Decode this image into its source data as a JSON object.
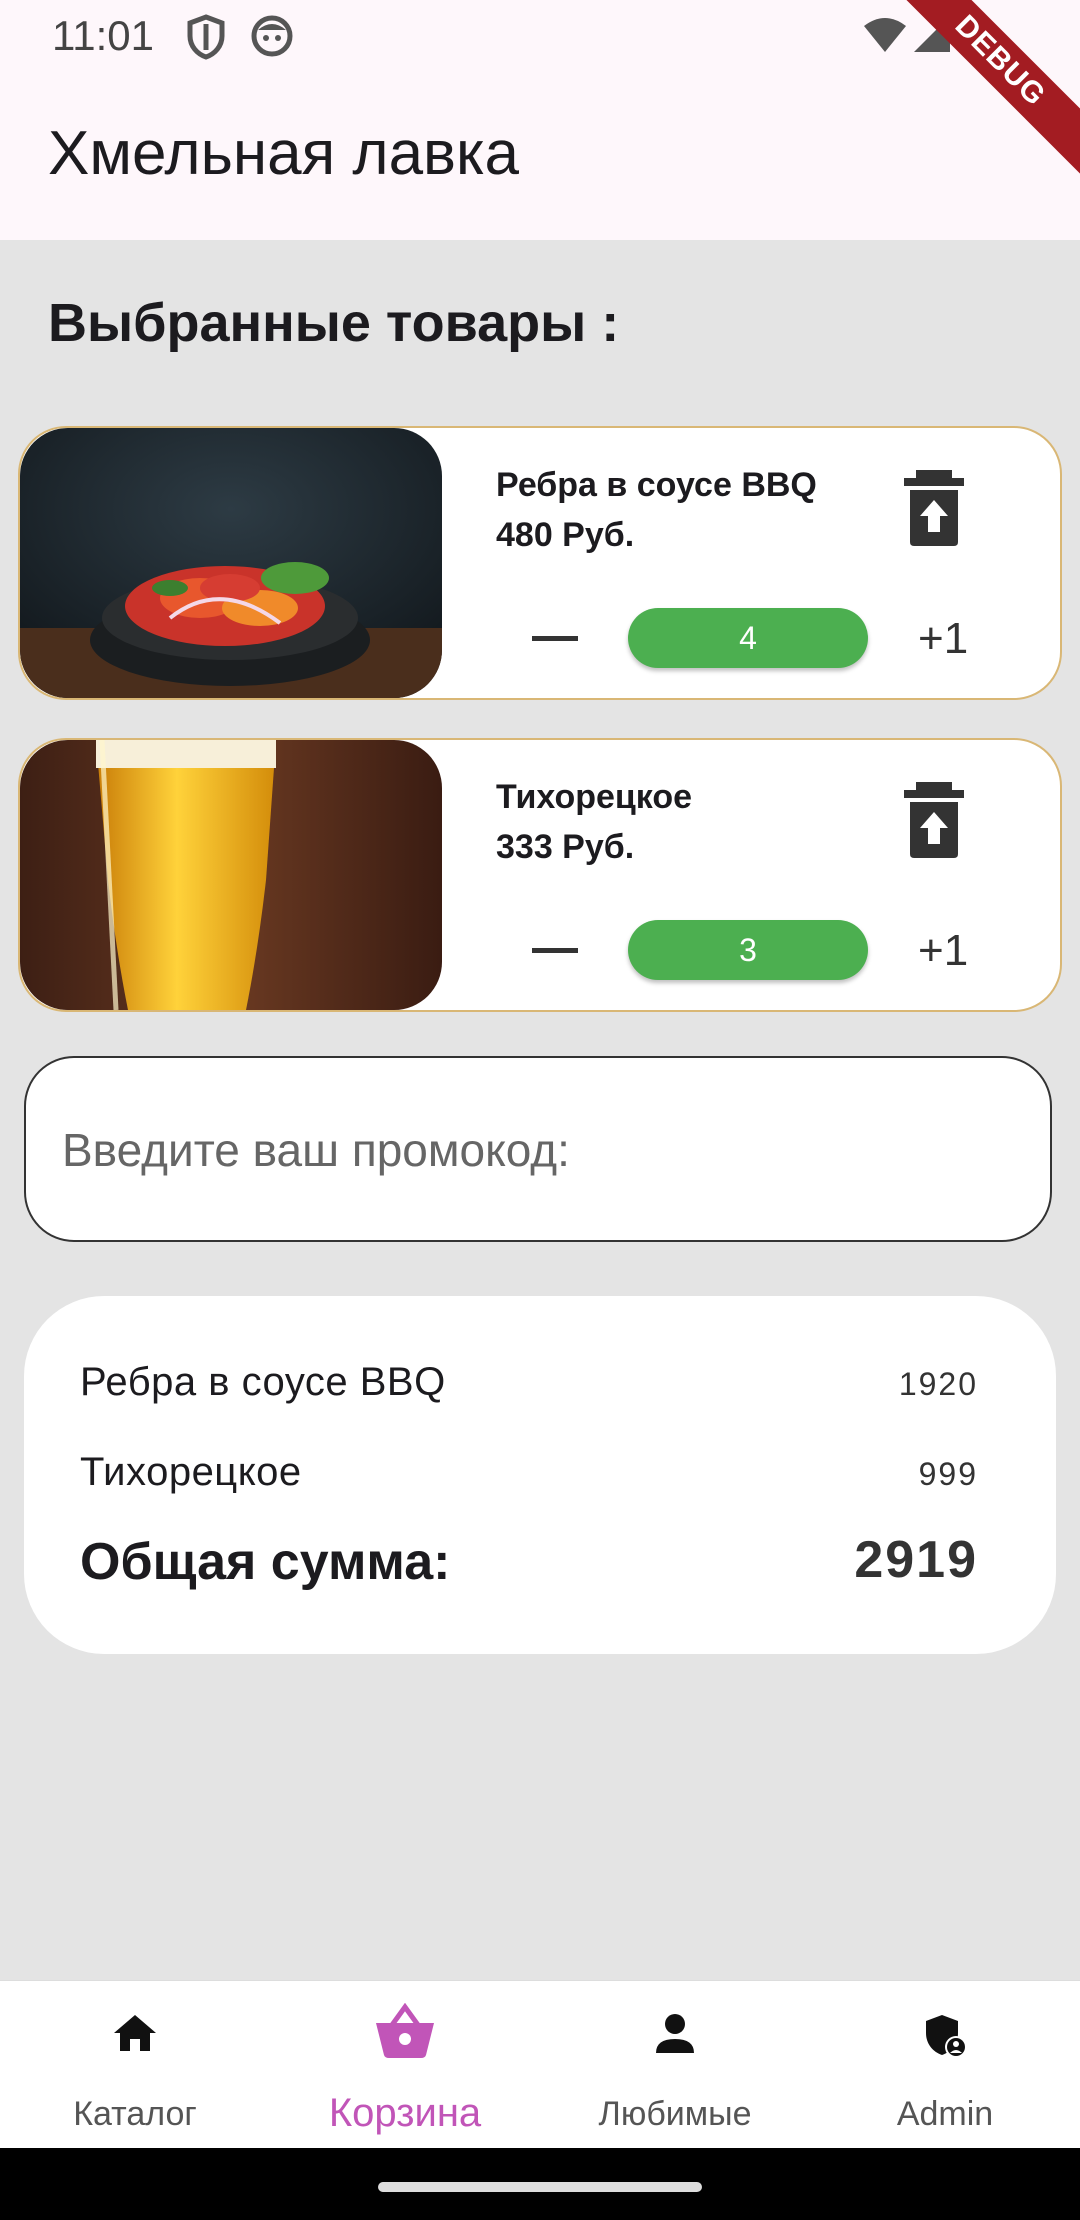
{
  "status_bar": {
    "time": "11:01",
    "debug_label": "DEBUG"
  },
  "app_bar": {
    "title": "Хмельная лавка"
  },
  "cart": {
    "section_title": "Выбранные товары :",
    "items": [
      {
        "name": "Ребра в соусе BBQ",
        "price": "480 Руб.",
        "quantity": "4",
        "increment_label": "+1"
      },
      {
        "name": "Тихорецкое",
        "price": "333 Руб.",
        "quantity": "3",
        "increment_label": "+1"
      }
    ]
  },
  "promo": {
    "placeholder": "Введите ваш промокод:",
    "value": ""
  },
  "summary": {
    "lines": [
      {
        "name": "Ребра в соусе BBQ",
        "value": "1920"
      },
      {
        "name": "Тихорецкое",
        "value": "999"
      }
    ],
    "total_label": "Общая сумма:",
    "total_value": "2919"
  },
  "bottom_nav": {
    "items": [
      {
        "label": "Каталог",
        "icon": "home-icon"
      },
      {
        "label": "Корзина",
        "icon": "basket-icon",
        "active": true
      },
      {
        "label": "Любимые",
        "icon": "person-icon"
      },
      {
        "label": "Admin",
        "icon": "admin-shield-icon"
      }
    ]
  },
  "colors": {
    "accent_pink": "#c155b8",
    "qty_green": "#4caf50",
    "card_border": "#d9b775",
    "background": "#e4e4e4",
    "debug_red": "#a31c22"
  }
}
